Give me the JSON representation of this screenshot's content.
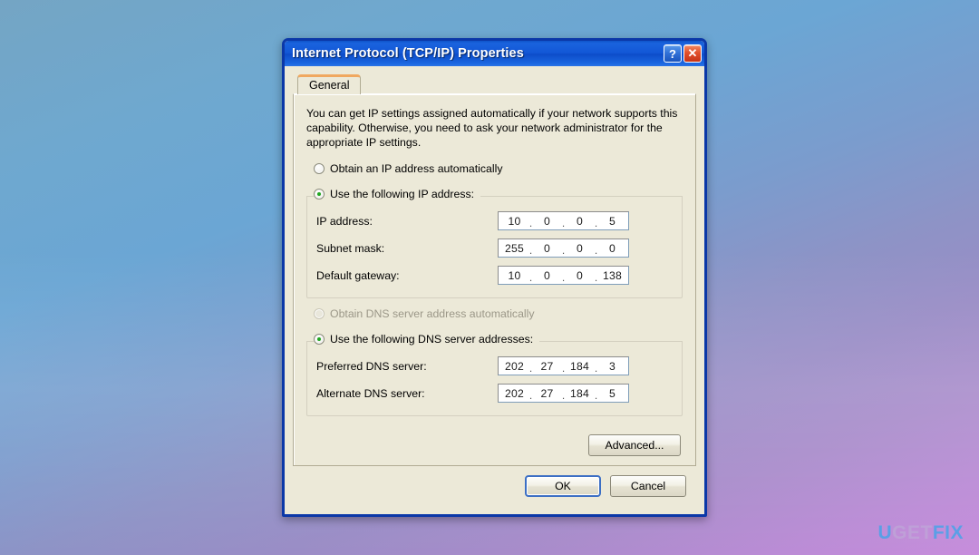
{
  "desktop": {
    "background_top_color": "#6ba6d4",
    "background_bottom_color": "#c78ddc"
  },
  "watermark": {
    "part1": "U",
    "part2": "GET",
    "part3": "FIX",
    "full_text": "UGETFIX"
  },
  "dialog": {
    "title": "Internet Protocol (TCP/IP) Properties",
    "help_button_label": "?",
    "close_button_label": "✕",
    "tabs": [
      {
        "label": "General",
        "selected": true
      }
    ],
    "description": "You can get IP settings assigned automatically if your network supports this capability. Otherwise, you need to ask your network administrator for the appropriate IP settings.",
    "ip_section": {
      "option_auto": {
        "label": "Obtain an IP address automatically",
        "selected": false,
        "disabled": false
      },
      "option_manual": {
        "label": "Use the following IP address:",
        "selected": true,
        "disabled": false
      },
      "fields": [
        {
          "label": "IP address:",
          "value": "10.0.0.5",
          "octets": [
            "10",
            "0",
            "0",
            "5"
          ]
        },
        {
          "label": "Subnet mask:",
          "value": "255.0.0.0",
          "octets": [
            "255",
            "0",
            "0",
            "0"
          ]
        },
        {
          "label": "Default gateway:",
          "value": "10.0.0.138",
          "octets": [
            "10",
            "0",
            "0",
            "138"
          ]
        }
      ]
    },
    "dns_section": {
      "option_auto": {
        "label": "Obtain DNS server address automatically",
        "selected": false,
        "disabled": true
      },
      "option_manual": {
        "label": "Use the following DNS server addresses:",
        "selected": true,
        "disabled": false
      },
      "fields": [
        {
          "label": "Preferred DNS server:",
          "value": "202.27.184.3",
          "octets": [
            "202",
            "27",
            "184",
            "3"
          ]
        },
        {
          "label": "Alternate DNS server:",
          "value": "202.27.184.5",
          "octets": [
            "202",
            "27",
            "184",
            "5"
          ]
        }
      ]
    },
    "advanced_button_label": "Advanced...",
    "ok_button_label": "OK",
    "cancel_button_label": "Cancel",
    "octet_separator": ".",
    "accent_color": "#0b38a8",
    "radio_dot_color": "#21a621",
    "titlebar_color": "#1257d6"
  }
}
